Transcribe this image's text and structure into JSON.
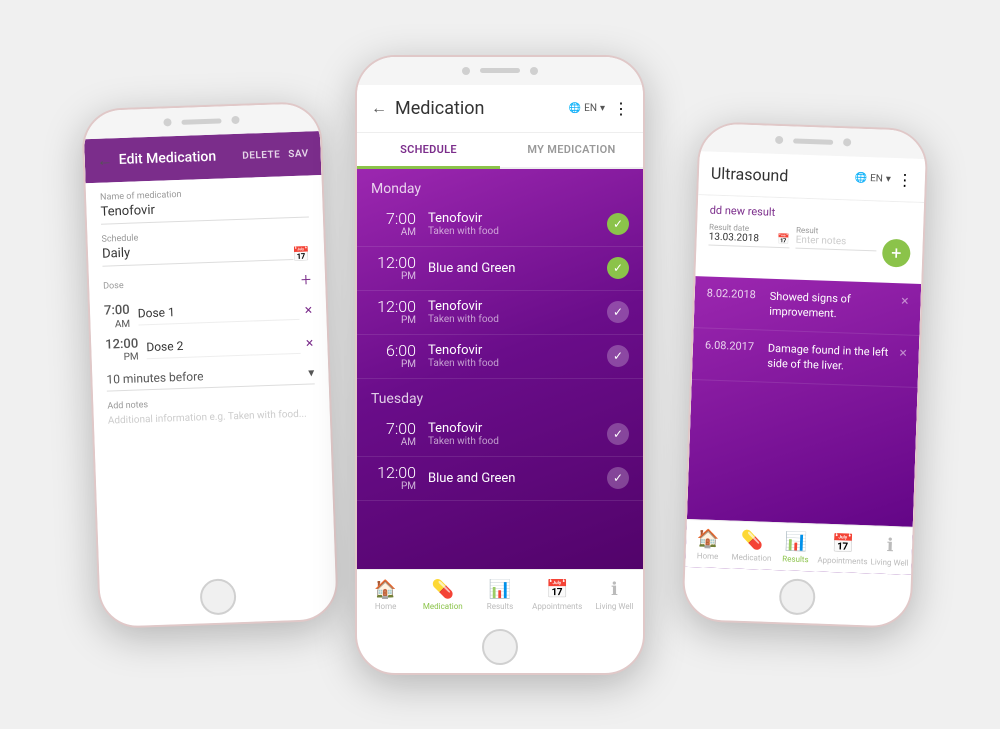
{
  "left_phone": {
    "header": {
      "back_label": "←",
      "title": "Edit Medication",
      "delete_label": "DELETE",
      "save_label": "SAV"
    },
    "fields": {
      "med_name_label": "Name of medication",
      "med_name_value": "Tenofovir",
      "schedule_label": "Schedule",
      "schedule_value": "Daily",
      "dose_label": "Dose",
      "doses": [
        {
          "time_big": "7:00",
          "time_ampm": "AM",
          "name": "Dose 1"
        },
        {
          "time_big": "12:00",
          "time_ampm": "PM",
          "name": "Dose 2"
        }
      ],
      "reminder_label": "10 minutes before",
      "notes_label": "Add notes",
      "notes_placeholder": "Additional information e.g. Taken with food..."
    }
  },
  "center_phone": {
    "header": {
      "back_label": "←",
      "title": "Medication",
      "lang": "EN",
      "dots": "⋮"
    },
    "tabs": [
      {
        "label": "SCHEDULE",
        "active": true
      },
      {
        "label": "MY MEDICATION",
        "active": false
      }
    ],
    "days": [
      {
        "name": "Monday",
        "items": [
          {
            "time_big": "7:00",
            "time_ampm": "AM",
            "med_name": "Tenofovir",
            "med_sub": "Taken with food",
            "checked": true
          },
          {
            "time_big": "12:00",
            "time_ampm": "PM",
            "med_name": "Blue and Green",
            "med_sub": "",
            "checked": true
          },
          {
            "time_big": "12:00",
            "time_ampm": "PM",
            "med_name": "Tenofovir",
            "med_sub": "Taken with food",
            "checked": false
          },
          {
            "time_big": "6:00",
            "time_ampm": "PM",
            "med_name": "Tenofovir",
            "med_sub": "Taken with food",
            "checked": false
          }
        ]
      },
      {
        "name": "Tuesday",
        "items": [
          {
            "time_big": "7:00",
            "time_ampm": "AM",
            "med_name": "Tenofovir",
            "med_sub": "Taken with food",
            "checked": false
          },
          {
            "time_big": "12:00",
            "time_ampm": "PM",
            "med_name": "Blue and Green",
            "med_sub": "",
            "checked": false
          }
        ]
      }
    ],
    "bottom_nav": [
      {
        "icon": "🏠",
        "label": "Home",
        "active": false
      },
      {
        "icon": "💊",
        "label": "Medication",
        "active": true
      },
      {
        "icon": "📊",
        "label": "Results",
        "active": false
      },
      {
        "icon": "📅",
        "label": "Appointments",
        "active": false
      },
      {
        "icon": "ℹ",
        "label": "Living Well",
        "active": false
      }
    ]
  },
  "right_phone": {
    "header": {
      "title": "Ultrasound",
      "lang": "EN",
      "dots": "⋮"
    },
    "add_result_label": "dd new result",
    "form": {
      "date_label": "Result date",
      "date_value": "13.03.2018",
      "result_label": "Result",
      "result_placeholder": "Enter notes"
    },
    "results": [
      {
        "date": "8.02.2018",
        "text": "Showed signs of improvement."
      },
      {
        "date": "6.08.2017",
        "text": "Damage found in the left side of the liver."
      }
    ],
    "bottom_nav": [
      {
        "icon": "🏠",
        "label": "Home",
        "active": false
      },
      {
        "icon": "💊",
        "label": "Medication",
        "active": false
      },
      {
        "icon": "📊",
        "label": "Results",
        "active": true
      },
      {
        "icon": "📅",
        "label": "Appointments",
        "active": false
      },
      {
        "icon": "ℹ",
        "label": "Living Well",
        "active": false
      }
    ]
  }
}
